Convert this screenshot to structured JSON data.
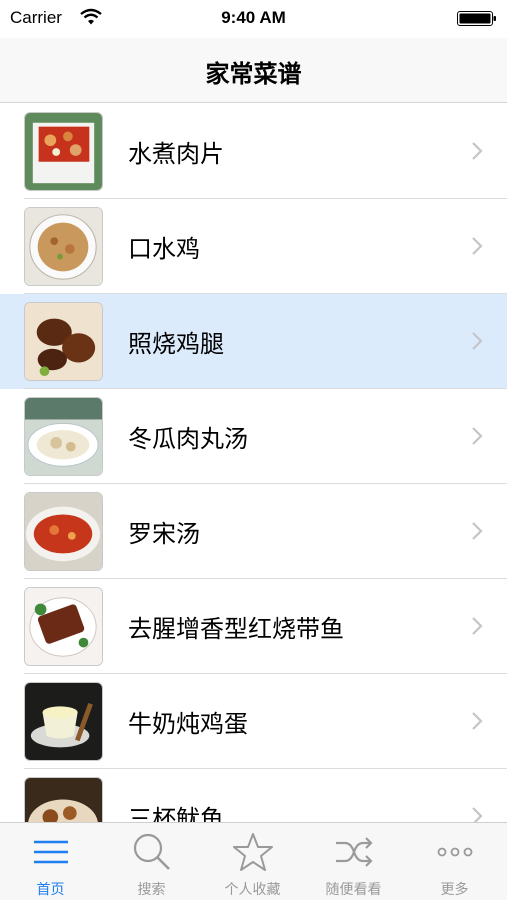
{
  "status": {
    "carrier": "Carrier",
    "time": "9:40 AM"
  },
  "nav": {
    "title": "家常菜谱"
  },
  "recipes": [
    {
      "name": "水煮肉片"
    },
    {
      "name": "口水鸡"
    },
    {
      "name": "照烧鸡腿"
    },
    {
      "name": "冬瓜肉丸汤"
    },
    {
      "name": "罗宋汤"
    },
    {
      "name": "去腥增香型红烧带鱼"
    },
    {
      "name": "牛奶炖鸡蛋"
    },
    {
      "name": "三杯鱿鱼"
    }
  ],
  "selected_index": 2,
  "tabs": [
    {
      "label": "首页",
      "icon": "menu-lines-icon"
    },
    {
      "label": "搜索",
      "icon": "search-icon"
    },
    {
      "label": "个人收藏",
      "icon": "star-icon"
    },
    {
      "label": "随便看看",
      "icon": "shuffle-icon"
    },
    {
      "label": "更多",
      "icon": "more-dots-icon"
    }
  ],
  "colors": {
    "accent": "#1e7ff0",
    "selected_row": "#dcebfb",
    "tab_inactive": "#9a9a9a"
  }
}
